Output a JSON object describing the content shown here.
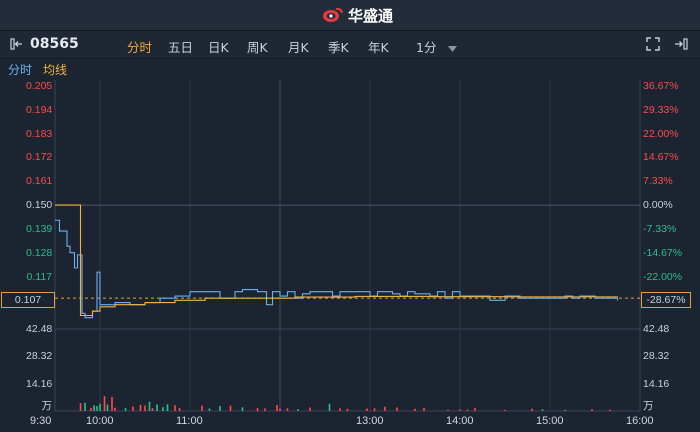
{
  "app": {
    "brand": "华盛通",
    "brand_icon": "huasheng-logo-icon"
  },
  "toolbar": {
    "symbol": "08565",
    "tabs": [
      {
        "label": "分时",
        "active": true
      },
      {
        "label": "五日",
        "active": false
      },
      {
        "label": "日K",
        "active": false
      },
      {
        "label": "周K",
        "active": false
      },
      {
        "label": "月K",
        "active": false
      },
      {
        "label": "季K",
        "active": false
      },
      {
        "label": "年K",
        "active": false
      }
    ],
    "interval": "1分",
    "icons": [
      "sidebar-toggle-icon",
      "expand-icon",
      "collapse-right-icon"
    ]
  },
  "legend": {
    "price": "分时",
    "avg": "均线"
  },
  "colors": {
    "up": "#ff4a4a",
    "down": "#27c08a",
    "neutral": "#c8d0dc",
    "price_line": "#6ab0f0",
    "avg_line": "#f0b43c",
    "accent": "#f2a93b"
  },
  "chart_data": {
    "type": "line",
    "prev_close": 0.15,
    "current_price": 0.107,
    "current_change": "-28.67%",
    "price_ticks_left": [
      "0.205",
      "0.194",
      "0.183",
      "0.172",
      "0.161",
      "0.150",
      "0.139",
      "0.128",
      "0.117",
      "0.107"
    ],
    "price_ticks_right": [
      "36.67%",
      "29.33%",
      "22.00%",
      "14.67%",
      "7.33%",
      "0.00%",
      "-7.33%",
      "-14.67%",
      "-22.00%",
      "-28.67%"
    ],
    "x_ticks": [
      "9:30",
      "10:00",
      "11:00",
      "13:00",
      "14:00",
      "15:00",
      "16:00"
    ],
    "volume_ticks": [
      "42.48",
      "28.32",
      "14.16"
    ],
    "volume_unit": "万",
    "price_series": [
      [
        0,
        0.143
      ],
      [
        3,
        0.138
      ],
      [
        8,
        0.131
      ],
      [
        10,
        0.128
      ],
      [
        13,
        0.121
      ],
      [
        15,
        0.127
      ],
      [
        18,
        0.1
      ],
      [
        20,
        0.098
      ],
      [
        25,
        0.101
      ],
      [
        28,
        0.119
      ],
      [
        30,
        0.104
      ],
      [
        40,
        0.105
      ],
      [
        50,
        0.104
      ],
      [
        60,
        0.105
      ],
      [
        70,
        0.107
      ],
      [
        80,
        0.108
      ],
      [
        90,
        0.11
      ],
      [
        100,
        0.11
      ],
      [
        110,
        0.107
      ],
      [
        120,
        0.11
      ],
      [
        125,
        0.111
      ],
      [
        135,
        0.11
      ],
      [
        141,
        0.104
      ],
      [
        145,
        0.11
      ],
      [
        150,
        0.108
      ],
      [
        155,
        0.11
      ],
      [
        160,
        0.107
      ],
      [
        165,
        0.109
      ],
      [
        170,
        0.11
      ],
      [
        180,
        0.11
      ],
      [
        185,
        0.108
      ],
      [
        190,
        0.11
      ],
      [
        200,
        0.11
      ],
      [
        210,
        0.108
      ],
      [
        215,
        0.11
      ],
      [
        225,
        0.109
      ],
      [
        230,
        0.108
      ],
      [
        235,
        0.11
      ],
      [
        240,
        0.109
      ],
      [
        250,
        0.108
      ],
      [
        255,
        0.11
      ],
      [
        260,
        0.107
      ],
      [
        265,
        0.11
      ],
      [
        270,
        0.108
      ],
      [
        290,
        0.106
      ],
      [
        300,
        0.108
      ],
      [
        310,
        0.107
      ],
      [
        320,
        0.107
      ],
      [
        330,
        0.107
      ],
      [
        340,
        0.108
      ],
      [
        345,
        0.107
      ],
      [
        350,
        0.108
      ],
      [
        360,
        0.107
      ],
      [
        370,
        0.107
      ],
      [
        375,
        0.106
      ]
    ],
    "avg_series": [
      [
        0,
        0.15
      ],
      [
        16,
        0.15
      ],
      [
        17,
        0.099
      ],
      [
        20,
        0.099
      ],
      [
        25,
        0.101
      ],
      [
        30,
        0.103
      ],
      [
        40,
        0.104
      ],
      [
        60,
        0.105
      ],
      [
        80,
        0.106
      ],
      [
        100,
        0.107
      ],
      [
        130,
        0.107
      ],
      [
        160,
        0.1075
      ],
      [
        200,
        0.1078
      ],
      [
        250,
        0.1077
      ],
      [
        300,
        0.1076
      ],
      [
        375,
        0.1075
      ]
    ],
    "volume_bars": [
      [
        17,
        4.1,
        "up"
      ],
      [
        20,
        4.3,
        "down"
      ],
      [
        24,
        1.6,
        "up"
      ],
      [
        26,
        3.0,
        "down"
      ],
      [
        28,
        2.6,
        "down"
      ],
      [
        30,
        3.8,
        "down"
      ],
      [
        33,
        7.7,
        "up"
      ],
      [
        35,
        3.3,
        "down"
      ],
      [
        38,
        7.3,
        "up"
      ],
      [
        40,
        1.7,
        "up"
      ],
      [
        47,
        1.5,
        "down"
      ],
      [
        52,
        2.3,
        "up"
      ],
      [
        57,
        3.2,
        "up"
      ],
      [
        60,
        2.8,
        "up"
      ],
      [
        63,
        4.8,
        "down"
      ],
      [
        65,
        1.5,
        "up"
      ],
      [
        68,
        3.4,
        "down"
      ],
      [
        72,
        2.0,
        "down"
      ],
      [
        75,
        3.5,
        "down"
      ],
      [
        80,
        3.0,
        "up"
      ],
      [
        83,
        1.5,
        "up"
      ],
      [
        98,
        2.8,
        "up"
      ],
      [
        103,
        1.3,
        "down"
      ],
      [
        110,
        2.6,
        "down"
      ],
      [
        117,
        2.8,
        "up"
      ],
      [
        125,
        1.9,
        "down"
      ],
      [
        135,
        1.5,
        "up"
      ],
      [
        140,
        1.4,
        "up"
      ],
      [
        148,
        3.1,
        "up"
      ],
      [
        150,
        1.3,
        "up"
      ],
      [
        155,
        1.4,
        "up"
      ],
      [
        162,
        0.9,
        "down"
      ],
      [
        170,
        1.8,
        "up"
      ],
      [
        183,
        3.8,
        "down"
      ],
      [
        190,
        1.4,
        "up"
      ],
      [
        195,
        1.1,
        "up"
      ],
      [
        208,
        1.3,
        "up"
      ],
      [
        213,
        1.4,
        "up"
      ],
      [
        220,
        2.2,
        "up"
      ],
      [
        228,
        1.8,
        "up"
      ],
      [
        240,
        1.2,
        "up"
      ],
      [
        246,
        1.6,
        "up"
      ],
      [
        262,
        0.6,
        "up"
      ],
      [
        270,
        0.8,
        "up"
      ],
      [
        275,
        0.7,
        "up"
      ],
      [
        280,
        1.5,
        "up"
      ],
      [
        300,
        0.6,
        "up"
      ],
      [
        318,
        1.2,
        "up"
      ],
      [
        325,
        0.9,
        "down"
      ],
      [
        340,
        0.6,
        "down"
      ],
      [
        358,
        0.9,
        "up"
      ],
      [
        370,
        0.7,
        "up"
      ]
    ]
  }
}
